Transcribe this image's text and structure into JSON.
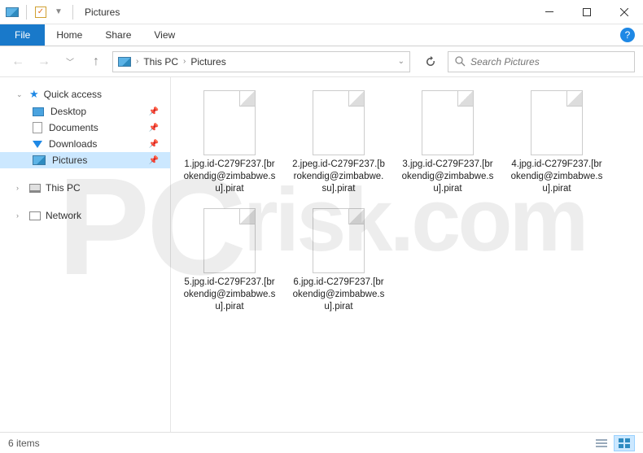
{
  "title": "Pictures",
  "ribbon": {
    "file": "File",
    "tabs": [
      "Home",
      "Share",
      "View"
    ]
  },
  "breadcrumb": {
    "parts": [
      "This PC",
      "Pictures"
    ]
  },
  "search": {
    "placeholder": "Search Pictures"
  },
  "sidebar": {
    "quick_access": "Quick access",
    "items": [
      {
        "label": "Desktop",
        "icon": "desktop"
      },
      {
        "label": "Documents",
        "icon": "doc"
      },
      {
        "label": "Downloads",
        "icon": "down"
      },
      {
        "label": "Pictures",
        "icon": "pic",
        "selected": true
      }
    ],
    "this_pc": "This PC",
    "network": "Network"
  },
  "files": [
    {
      "name": "1.jpg.id-C279F237.[brokendig@zimbabwe.su].pirat"
    },
    {
      "name": "2.jpeg.id-C279F237.[brokendig@zimbabwe.su].pirat"
    },
    {
      "name": "3.jpg.id-C279F237.[brokendig@zimbabwe.su].pirat"
    },
    {
      "name": "4.jpg.id-C279F237.[brokendig@zimbabwe.su].pirat"
    },
    {
      "name": "5.jpg.id-C279F237.[brokendig@zimbabwe.su].pirat"
    },
    {
      "name": "6.jpg.id-C279F237.[brokendig@zimbabwe.su].pirat"
    }
  ],
  "status": {
    "count": "6 items"
  },
  "watermark": "risk.com"
}
